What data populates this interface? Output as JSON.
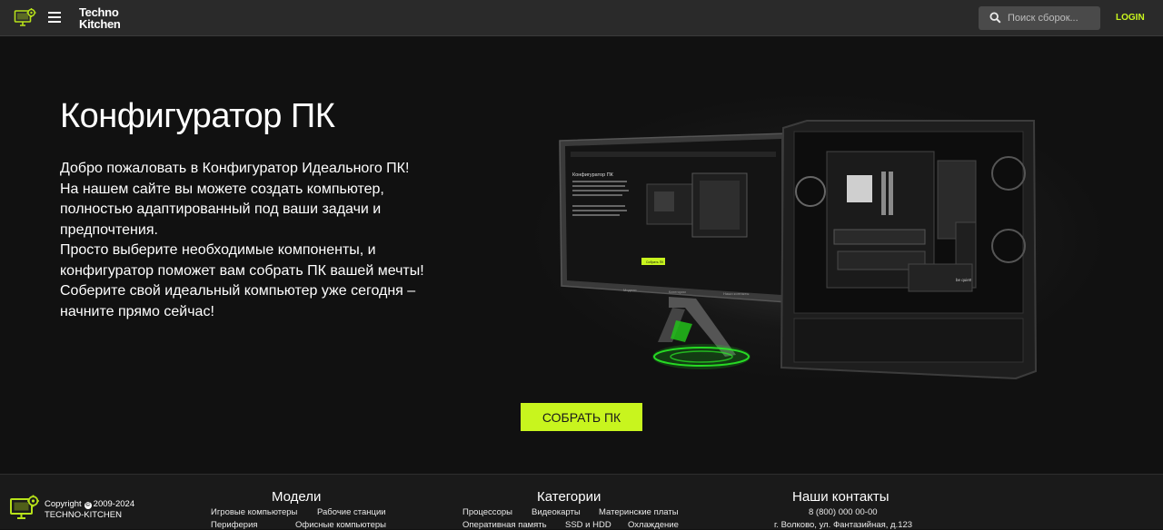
{
  "header": {
    "brand_line1": "Techno",
    "brand_line2": "Kitchen",
    "search_placeholder": "Поиск сборок...",
    "login_label": "LOGIN"
  },
  "hero": {
    "title": "Конфигуратор ПК",
    "paragraphs": [
      "Добро пожаловать в Конфигуратор Идеального ПК!",
      "На нашем сайте вы можете создать компьютер, полностью адаптированный под ваши задачи и предпочтения.",
      "Просто выберите необходимые компоненты, и конфигуратор поможет вам собрать ПК вашей мечты!",
      "Соберите свой идеальный компьютер уже сегодня – начните прямо сейчас!"
    ],
    "build_button": "СОБРАТЬ ПК",
    "monitor_title": "Конфигуратор ПК",
    "monitor_button": "Собрать ПК",
    "monitor_nav": [
      "Модели",
      "Категории",
      "Наши контакты"
    ],
    "case_badge": "be quiet!"
  },
  "footer": {
    "copyright_label": "Copyright",
    "copyright_years": "2009-2024",
    "company": "TECHNO-KITCHEN",
    "models": {
      "title": "Модели",
      "links": [
        "Игровые компьютеры",
        "Рабочие станции",
        "Периферия",
        "Офисные компьютеры"
      ]
    },
    "categories": {
      "title": "Категории",
      "links": [
        "Процессоры",
        "Видеокарты",
        "Материнские платы",
        "Оперативная память",
        "SSD и HDD",
        "Охлаждение"
      ]
    },
    "contacts": {
      "title": "Наши контакты",
      "phone": "8 (800) 000 00-00",
      "address": "г. Волково, ул. Фантазийная, д.123"
    }
  },
  "colors": {
    "accent": "#c8f51e",
    "background": "#111111",
    "header_bg": "#2a2a2a",
    "footer_bg": "#1a1a1a"
  },
  "icons": [
    "logo-icon",
    "menu-icon",
    "search-icon",
    "copyright-icon"
  ]
}
